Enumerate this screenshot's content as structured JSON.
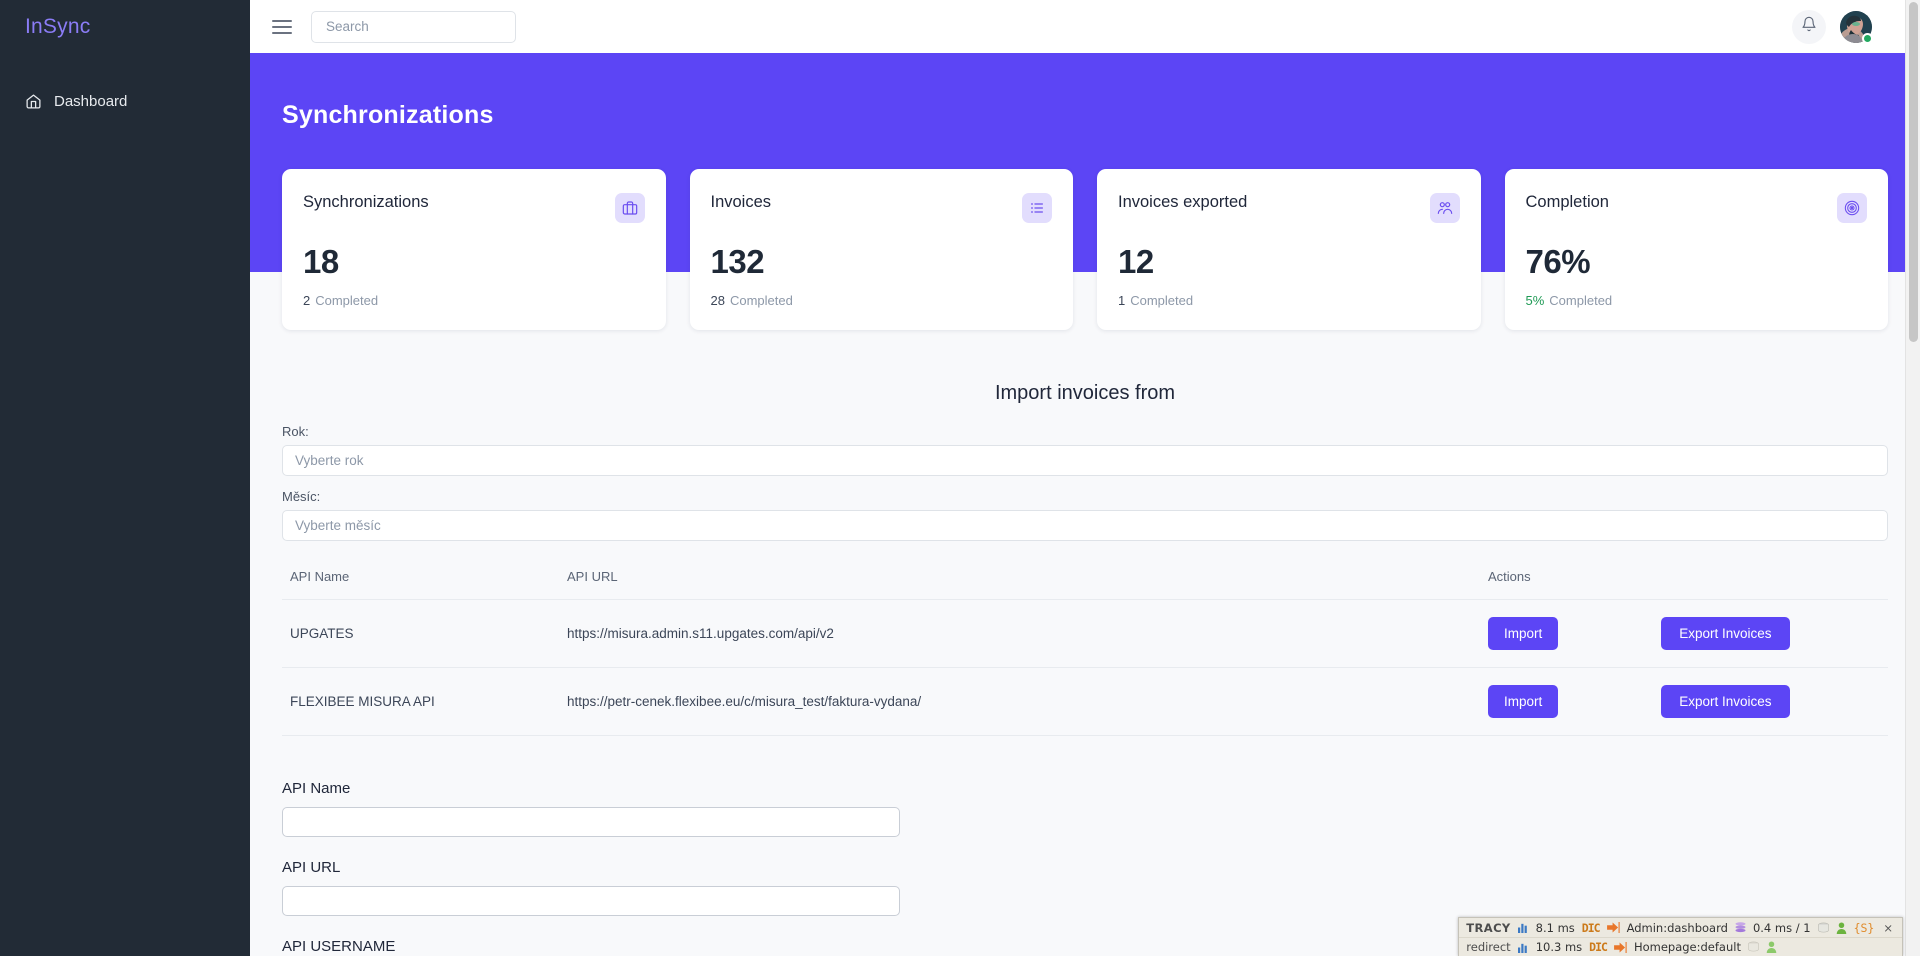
{
  "sidebar": {
    "brand": "InSync",
    "items": [
      {
        "label": "Dashboard",
        "icon": "home-icon"
      }
    ]
  },
  "topbar": {
    "menu_icon": "hamburger-icon",
    "search": {
      "placeholder": "Search",
      "value": ""
    },
    "bell_icon": "bell-icon",
    "avatar_icon": "user-avatar",
    "status": "online"
  },
  "banner": {
    "title": "Synchronizations",
    "color": "#5c45f5"
  },
  "cards": [
    {
      "label": "Synchronizations",
      "value": "18",
      "sub_number": "2",
      "sub_text": "Completed",
      "icon": "briefcase-icon",
      "sub_color": "#3c4658"
    },
    {
      "label": "Invoices",
      "value": "132",
      "sub_number": "28",
      "sub_text": "Completed",
      "icon": "list-icon",
      "sub_color": "#3c4658"
    },
    {
      "label": "Invoices exported",
      "value": "12",
      "sub_number": "1",
      "sub_text": "Completed",
      "icon": "users-icon",
      "sub_color": "#3c4658"
    },
    {
      "label": "Completion",
      "value": "76%",
      "sub_number": "5%",
      "sub_text": "Completed",
      "icon": "target-icon",
      "sub_color": "#1f9a55"
    }
  ],
  "import": {
    "heading": "Import invoices from",
    "year": {
      "label": "Rok:",
      "placeholder": "Vyberte rok",
      "value": ""
    },
    "month": {
      "label": "Měsíc:",
      "placeholder": "Vyberte měsíc",
      "value": ""
    }
  },
  "table": {
    "headers": {
      "name": "API Name",
      "url": "API URL",
      "actions": "Actions"
    },
    "rows": [
      {
        "name": "UPGATES",
        "url": "https://misura.admin.s11.upgates.com/api/v2",
        "import_label": "Import",
        "export_label": "Export Invoices"
      },
      {
        "name": "FLEXIBEE MISURA API",
        "url": "https://petr-cenek.flexibee.eu/c/misura_test/faktura-vydana/",
        "import_label": "Import",
        "export_label": "Export Invoices"
      }
    ]
  },
  "form": {
    "fields": [
      {
        "label": "API Name",
        "value": "",
        "placeholder": ""
      },
      {
        "label": "API URL",
        "value": "",
        "placeholder": ""
      },
      {
        "label": "API USERNAME",
        "value": "",
        "placeholder": ""
      }
    ]
  },
  "tracy": {
    "row1": {
      "label": "TRACY",
      "time": "8.1 ms",
      "dic": "DIC",
      "route": "Admin:dashboard",
      "db": "0.4 ms / 1",
      "snippet": "{S}",
      "close": "×"
    },
    "row2": {
      "label": "redirect",
      "time": "10.3 ms",
      "dic": "DIC",
      "route": "Homepage:default"
    }
  }
}
